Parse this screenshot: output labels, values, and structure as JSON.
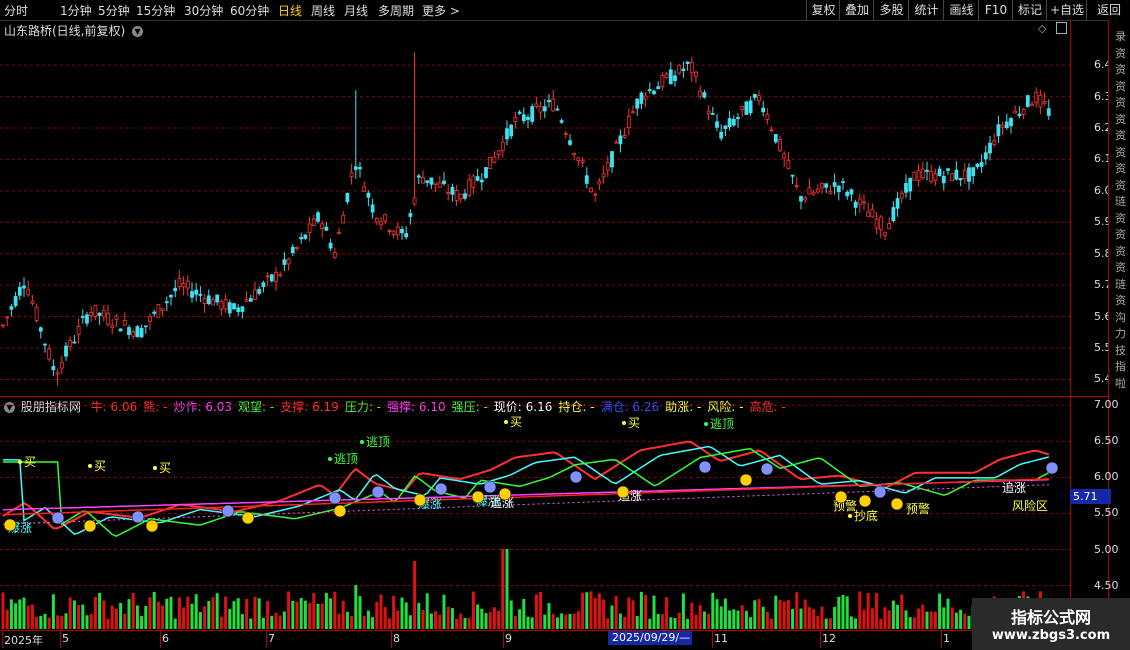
{
  "toolbar": {
    "periods": [
      "分时",
      "1分钟",
      "5分钟",
      "15分钟",
      "30分钟",
      "60分钟",
      "日线",
      "周线",
      "月线",
      "多周期",
      "更多 >"
    ],
    "active_period": "日线",
    "right_buttons": [
      "复权",
      "叠加",
      "多股",
      "统计",
      "画线",
      "F10",
      "标记",
      "+自选",
      "返回"
    ]
  },
  "main_chart": {
    "title": "山东路桥(日线,前复权)",
    "y_ticks": [
      "6.40",
      "6.30",
      "6.20",
      "6.10",
      "6.00",
      "5.90",
      "5.80",
      "5.70",
      "5.60",
      "5.50",
      "5.40"
    ],
    "y_min": 5.36,
    "y_max": 6.48
  },
  "right_panel_chars": [
    "录",
    "资",
    "资",
    "资",
    "资",
    "资",
    "资",
    "资",
    "资",
    "资",
    "琏",
    "资",
    "资",
    "资",
    "资",
    "琏",
    "资",
    "沟",
    "力",
    "技",
    "指",
    "啦"
  ],
  "indicator": {
    "name": "股朋指标网",
    "fields": [
      {
        "label": "牛:",
        "value": "6.06",
        "color": "#ff3030"
      },
      {
        "label": "熊:",
        "value": "-",
        "color": "#ff3030"
      },
      {
        "label": "炒作:",
        "value": "6.03",
        "color": "#ff40ff"
      },
      {
        "label": "观望:",
        "value": "-",
        "color": "#40ff40"
      },
      {
        "label": "支撑:",
        "value": "6.19",
        "color": "#ff3030"
      },
      {
        "label": "压力:",
        "value": "-",
        "color": "#40ff40"
      },
      {
        "label": "强撑:",
        "value": "6.10",
        "color": "#ff40ff"
      },
      {
        "label": "强压:",
        "value": "-",
        "color": "#40ff40"
      },
      {
        "label": "现价:",
        "value": "6.16",
        "color": "#ffffff"
      },
      {
        "label": "持仓:",
        "value": "-",
        "color": "#ffff40"
      },
      {
        "label": "满仓:",
        "value": "6.26",
        "color": "#3050ff"
      },
      {
        "label": "助涨:",
        "value": "-",
        "color": "#ffff40"
      },
      {
        "label": "风险:",
        "value": "-",
        "color": "#ffff40"
      },
      {
        "label": "高危:",
        "value": "-",
        "color": "#ff3030"
      }
    ],
    "y_ticks": [
      "7.00",
      "6.50",
      "6.00",
      "5.50",
      "5.00",
      "4.50"
    ],
    "y_min": 4.3,
    "y_max": 7.1,
    "current_price": "5.71",
    "signals": [
      {
        "text": "买",
        "color": "#ffff40"
      },
      {
        "text": "买",
        "color": "#ffff40"
      },
      {
        "text": "买",
        "color": "#ffff40"
      },
      {
        "text": "逃顶",
        "color": "#40ff40"
      },
      {
        "text": "逃顶",
        "color": "#40ff40"
      },
      {
        "text": "买",
        "color": "#ffff40"
      },
      {
        "text": "买",
        "color": "#ffff40"
      },
      {
        "text": "逃顶",
        "color": "#40ff40"
      },
      {
        "text": "爆涨",
        "color": "#40ffff"
      },
      {
        "text": "爆涨",
        "color": "#40ffff"
      },
      {
        "text": "爆涨",
        "color": "#40ffff"
      },
      {
        "text": "追涨",
        "color": "#ffffff"
      },
      {
        "text": "追涨",
        "color": "#ffffff"
      },
      {
        "text": "预警",
        "color": "#ffff40"
      },
      {
        "text": "抄底",
        "color": "#ffff40"
      },
      {
        "text": "预警",
        "color": "#ffff40"
      },
      {
        "text": "追涨",
        "color": "#ffffff"
      },
      {
        "text": "风险区",
        "color": "#ffff40"
      }
    ]
  },
  "x_axis": {
    "labels": [
      "2025年",
      "5",
      "6",
      "7",
      "8",
      "9",
      "11",
      "12",
      "1"
    ],
    "highlight": "2025/09/29/—"
  },
  "watermark": {
    "line1": "指标公式网",
    "line2": "www.zbgs3.com"
  },
  "colors": {
    "up": "#ff3333",
    "down": "#40e0f0",
    "axis": "#b00000",
    "active": "#ffd000"
  }
}
